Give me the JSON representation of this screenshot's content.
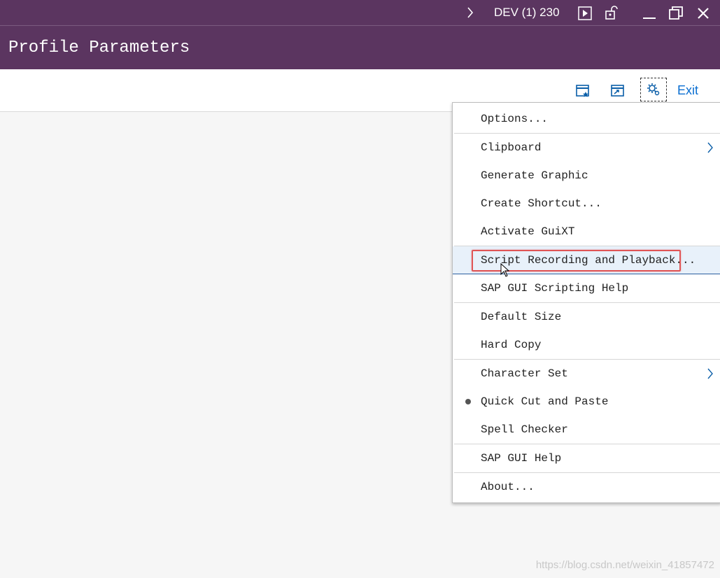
{
  "window": {
    "system_label": "DEV (1) 230",
    "icons": [
      "chevron-right-icon",
      "play-icon",
      "unlock-icon",
      "minimize-icon",
      "maximize-icon",
      "close-icon"
    ]
  },
  "header": {
    "title": "Profile Parameters"
  },
  "toolbar": {
    "icons": [
      "new-window-icon",
      "switch-window-icon",
      "settings-gear-icon"
    ],
    "exit_label": "Exit"
  },
  "menu": {
    "items": [
      {
        "label": "Options...",
        "mnemonic": "O"
      },
      {
        "label": "Clipboard",
        "mnemonic": "l",
        "submenu": true
      },
      {
        "label": "Generate Graphic",
        "mnemonic": "G"
      },
      {
        "label": "Create Shortcut...",
        "mnemonic": "u"
      },
      {
        "label": "Activate GuiXT",
        "mnemonic": "A"
      },
      {
        "label": "Script Recording and Playback...",
        "mnemonic": "P",
        "hovered": true
      },
      {
        "label": "SAP GUI Scripting Help",
        "mnemonic": "r"
      },
      {
        "label": "Default Size",
        "mnemonic": "e"
      },
      {
        "label": "Hard Copy",
        "mnemonic": "H"
      },
      {
        "label": "Character Set",
        "submenu": true
      },
      {
        "label": "Quick Cut and Paste",
        "mnemonic": "Q",
        "checked": true
      },
      {
        "label": "Spell Checker",
        "mnemonic": "k"
      },
      {
        "label": "SAP GUI Help",
        "mnemonic": "I"
      },
      {
        "label": "About...",
        "mnemonic": "b"
      }
    ]
  },
  "colors": {
    "header_bg": "#5b3560",
    "accent_blue": "#0a6ed1",
    "highlight_red": "#e05555"
  },
  "watermark": "https://blog.csdn.net/weixin_41857472"
}
